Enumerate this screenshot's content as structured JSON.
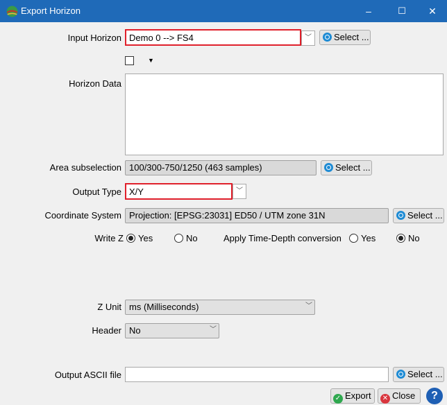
{
  "window": {
    "title": "Export Horizon",
    "minimize": "–",
    "maximize": "☐",
    "close": "✕"
  },
  "input_horizon": {
    "label": "Input Horizon",
    "value": "Demo 0 --> FS4",
    "select_label": "Select ..."
  },
  "horizon_data": {
    "label": "Horizon Data"
  },
  "area_subselection": {
    "label": "Area subselection",
    "value": "100/300-750/1250 (463 samples)",
    "select_label": "Select ..."
  },
  "output_type": {
    "label": "Output Type",
    "value": "X/Y"
  },
  "coordinate_system": {
    "label": "Coordinate System",
    "value": "Projection: [EPSG:23031] ED50 / UTM zone 31N",
    "select_label": "Select ..."
  },
  "write_z": {
    "label": "Write Z",
    "yes": "Yes",
    "no": "No",
    "selected": "Yes"
  },
  "time_depth": {
    "label": "Apply Time-Depth conversion",
    "yes": "Yes",
    "no": "No",
    "selected": "No"
  },
  "z_unit": {
    "label": "Z Unit",
    "value": "ms (Milliseconds)"
  },
  "header": {
    "label": "Header",
    "value": "No"
  },
  "output_file": {
    "label": "Output ASCII file",
    "value": "",
    "select_label": "Select ..."
  },
  "footer": {
    "export_label": "Export",
    "close_label": "Close",
    "help_label": "?"
  },
  "colors": {
    "titlebar": "#1f6ab8",
    "highlight": "#e0202b",
    "export_icon": "#2fa84f",
    "close_icon": "#d9363e",
    "help_icon": "#1e5fb4"
  }
}
